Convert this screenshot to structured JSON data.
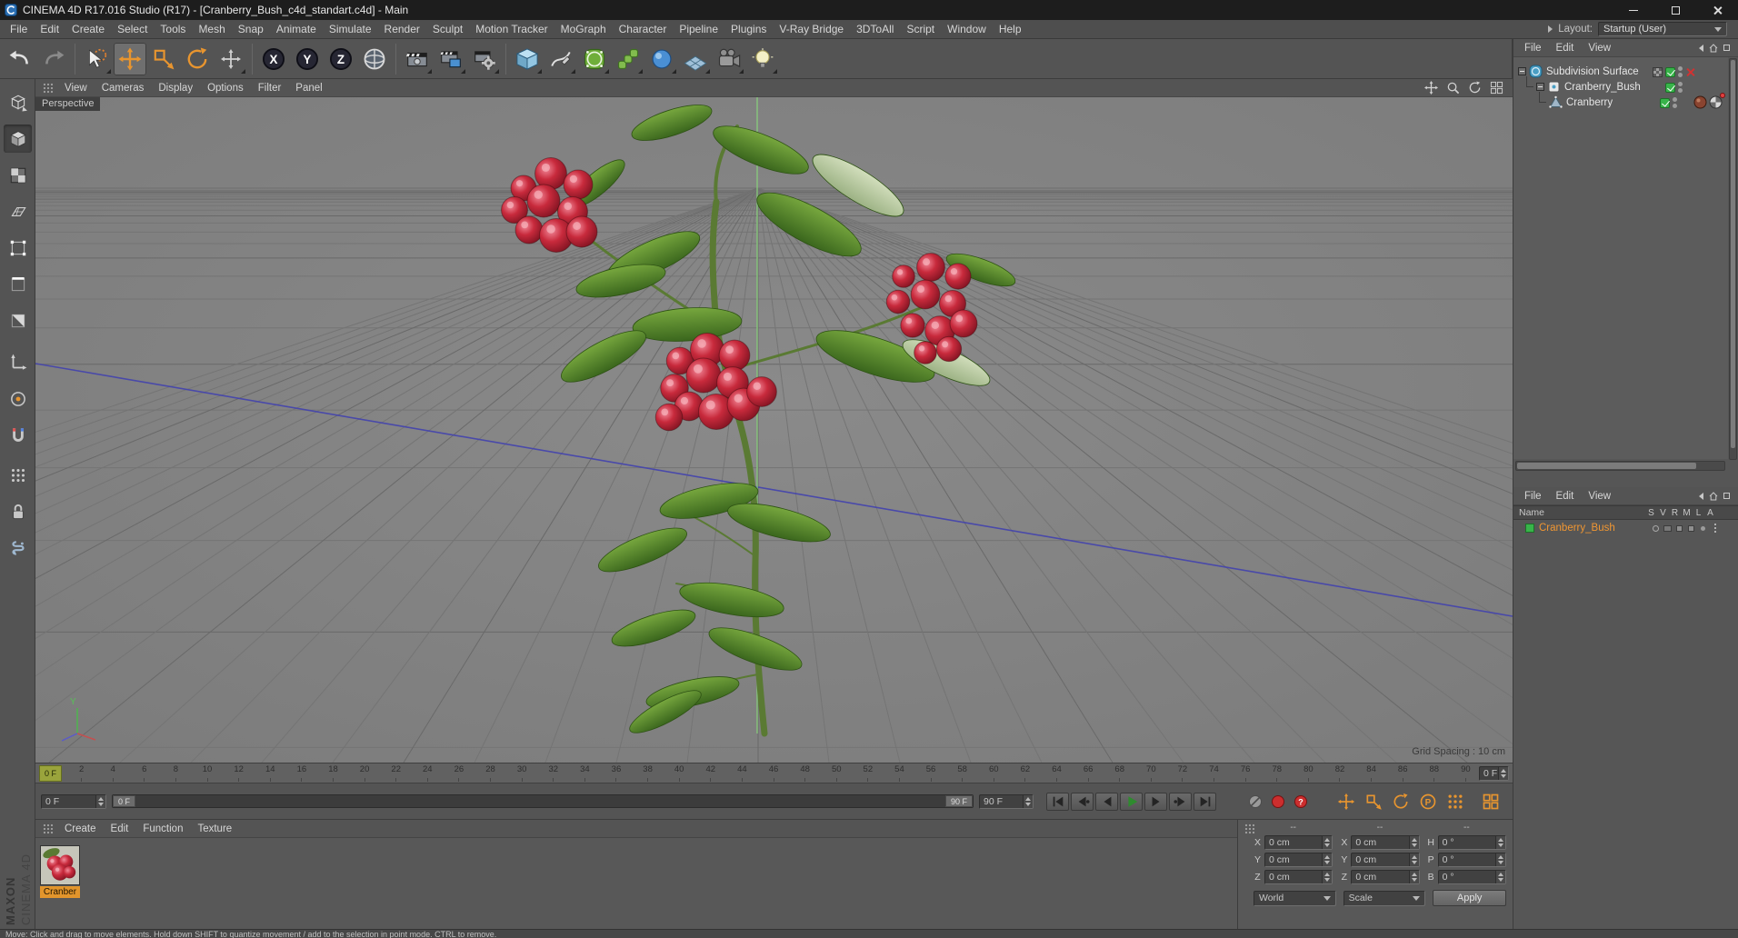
{
  "window": {
    "title": "CINEMA 4D R17.016 Studio (R17) - [Cranberry_Bush_c4d_standart.c4d] - Main"
  },
  "menubar": {
    "items": [
      "File",
      "Edit",
      "Create",
      "Select",
      "Tools",
      "Mesh",
      "Snap",
      "Animate",
      "Simulate",
      "Render",
      "Sculpt",
      "Motion Tracker",
      "MoGraph",
      "Character",
      "Pipeline",
      "Plugins",
      "V-Ray Bridge",
      "3DToAll",
      "Script",
      "Window",
      "Help"
    ],
    "layout_label": "Layout:",
    "layout_value": "Startup (User)"
  },
  "toolbar": {
    "icons": [
      "undo",
      "redo",
      "live-selection",
      "move",
      "scale",
      "rotate",
      "last-used-tool",
      "lock-x-axis",
      "lock-y-axis",
      "lock-z-axis",
      "coordinate-system",
      "render-view",
      "render-to-picture-viewer",
      "edit-render-settings",
      "add-cube",
      "freehand-spline",
      "subdivision-surface",
      "mograph-cloner",
      "simulation",
      "floor",
      "camera",
      "light"
    ],
    "axis_letters": [
      "X",
      "Y",
      "Z"
    ]
  },
  "left_palette": {
    "icons": [
      "make-editable",
      "model-mode",
      "texture-mode",
      "workplane-mode",
      "points-mode",
      "edges-mode",
      "polygons-mode",
      "enable-axis",
      "viewport-solo",
      "enable-snap",
      "quantize",
      "lock-workplane",
      "scripting"
    ]
  },
  "viewport": {
    "menus": [
      "View",
      "Cameras",
      "Display",
      "Options",
      "Filter",
      "Panel"
    ],
    "view_label": "Perspective",
    "grid_spacing_label": "Grid Spacing : 10 cm",
    "axis_y_label": "Y"
  },
  "timeline": {
    "ticks": [
      0,
      2,
      4,
      6,
      8,
      10,
      12,
      14,
      16,
      18,
      20,
      22,
      24,
      26,
      28,
      30,
      32,
      34,
      36,
      38,
      40,
      42,
      44,
      46,
      48,
      50,
      52,
      54,
      56,
      58,
      60,
      62,
      64,
      66,
      68,
      70,
      72,
      74,
      76,
      78,
      80,
      82,
      84,
      86,
      88,
      90
    ],
    "playhead_label": "0 F",
    "ruler_end_field": "0 F"
  },
  "animation": {
    "current_frame": "0 F",
    "range_start": "0 F",
    "range_end": "90 F",
    "end_frame": "90 F",
    "transport": [
      "go-to-start",
      "go-to-previous-key",
      "go-to-previous-frame",
      "play-forwards",
      "go-to-next-frame",
      "go-to-next-key",
      "go-to-end"
    ],
    "record_buttons": [
      "record-keyframe",
      "record-active-objects",
      "autokeying"
    ],
    "record_toggles": [
      "record-position",
      "record-scale",
      "record-rotation",
      "record-parameter",
      "record-point-level"
    ],
    "parameter_letter": "P",
    "autokey_mark": "?"
  },
  "object_manager": {
    "menus": [
      "File",
      "Edit",
      "View"
    ],
    "rows": [
      {
        "label": "Subdivision Surface"
      },
      {
        "label": "Cranberry_Bush"
      },
      {
        "label": "Cranberry"
      }
    ]
  },
  "layer_manager": {
    "menus": [
      "File",
      "Edit",
      "View"
    ],
    "name_header": "Name",
    "columns": [
      "S",
      "V",
      "R",
      "M",
      "L",
      "A"
    ],
    "rows": [
      {
        "label": "Cranberry_Bush"
      }
    ]
  },
  "material_manager": {
    "menus": [
      "Create",
      "Edit",
      "Function",
      "Texture"
    ],
    "materials": [
      {
        "label": "Cranber"
      }
    ]
  },
  "coordinates": {
    "headers": [
      "--",
      "--",
      "--"
    ],
    "position": {
      "labels": [
        "X",
        "Y",
        "Z"
      ],
      "values": [
        "0 cm",
        "0 cm",
        "0 cm"
      ]
    },
    "size": {
      "labels": [
        "X",
        "Y",
        "Z"
      ],
      "values": [
        "0 cm",
        "0 cm",
        "0 cm"
      ]
    },
    "rotation": {
      "labels": [
        "H",
        "P",
        "B"
      ],
      "values": [
        "0 °",
        "0 °",
        "0 °"
      ]
    },
    "space": "World",
    "mode": "Scale",
    "apply": "Apply"
  },
  "status_bar": {
    "text": "Move: Click and drag to move elements. Hold down SHIFT to quantize movement / add to the selection in point mode. CTRL to remove."
  },
  "branding": {
    "maxon": "MAXON",
    "cinema": "CINEMA 4D"
  },
  "colors": {
    "accent_orange": "#e8952f",
    "check_green": "#38b44a",
    "selected_orange": "#f09632",
    "berry_red": "#b22334",
    "leaf_green": "#4a7a24",
    "viewport_gray": "#828282"
  }
}
